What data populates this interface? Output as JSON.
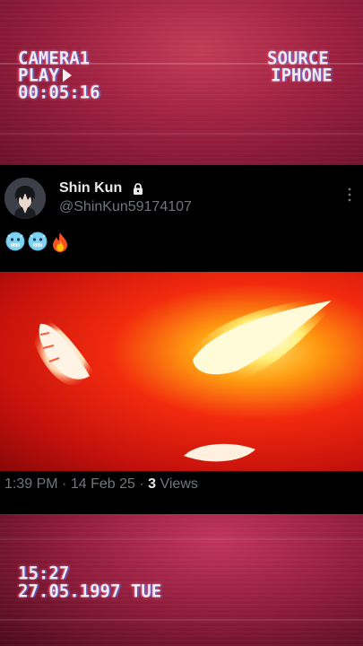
{
  "vhs_overlay": {
    "camera_label": "CAMERA1",
    "play_label": "PLAY",
    "elapsed": "00:05:16",
    "source_label": "SOURCE",
    "source_device": "IPHONE",
    "clock": "15:27",
    "date": "27.05.1997 TUE"
  },
  "tweet": {
    "display_name": "Shin Kun",
    "handle": "@ShinKun59174107",
    "emojis": [
      "cold-face",
      "cold-face",
      "fire"
    ],
    "time": "1:39 PM",
    "date": "14 Feb 25",
    "views_count": "3",
    "views_label": "Views",
    "separator": "·"
  },
  "colors": {
    "accent_text": "#e7e9ea",
    "muted_text": "#71767b",
    "background": "#000000"
  }
}
